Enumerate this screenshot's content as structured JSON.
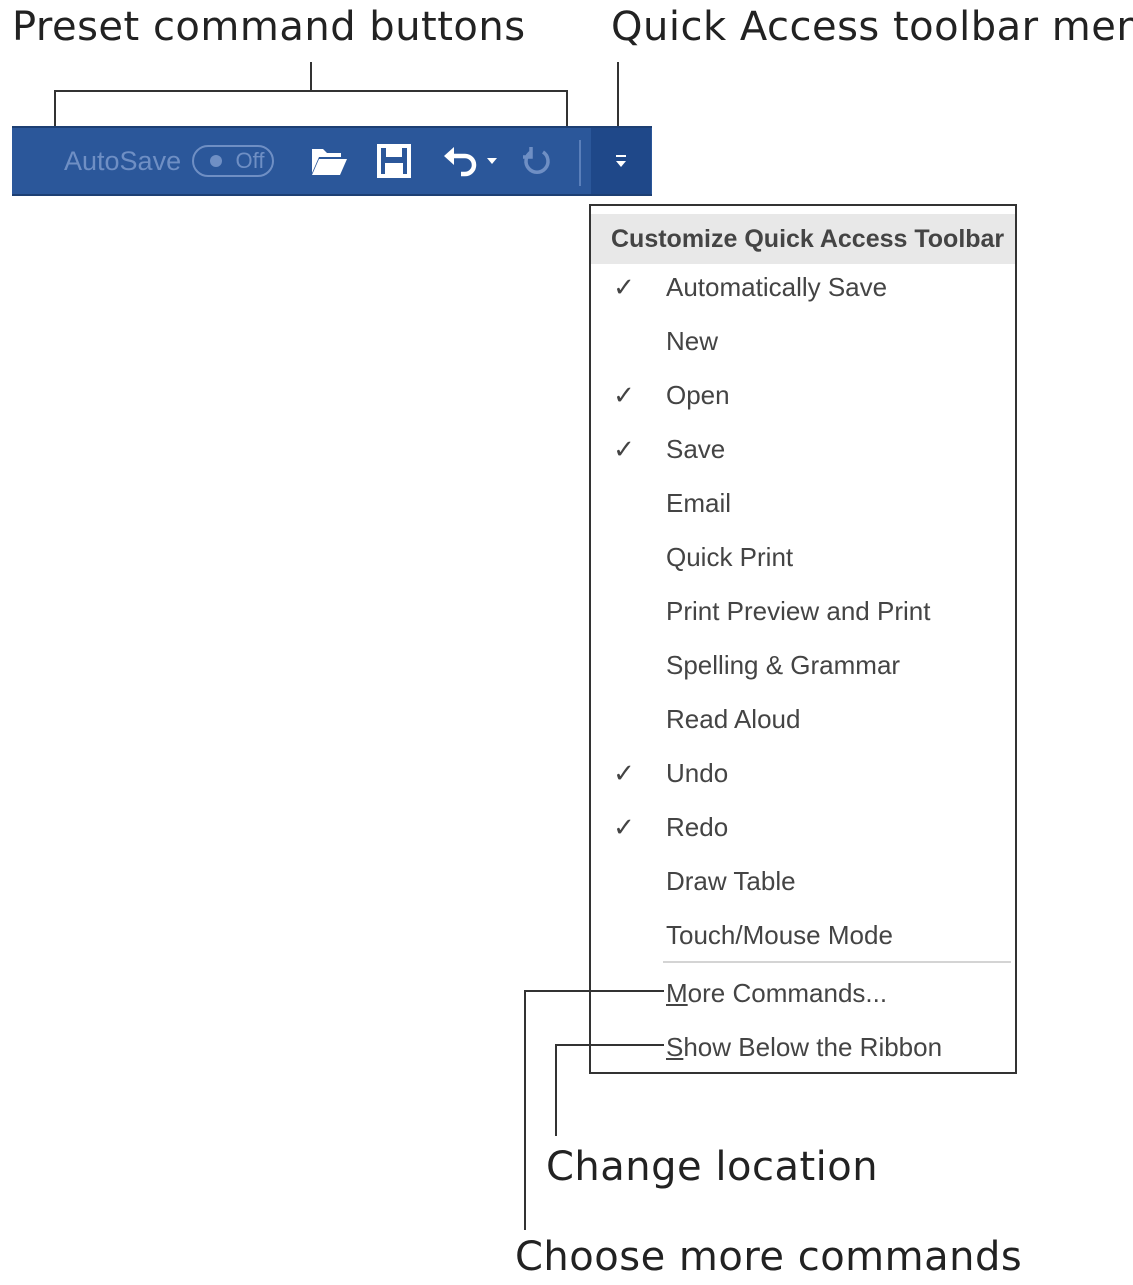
{
  "callouts": {
    "preset_buttons": "Preset command buttons",
    "qat_menu": "Quick Access toolbar menu",
    "change_location": "Change location",
    "more_commands": "Choose more commands"
  },
  "toolbar": {
    "autosave_label": "AutoSave",
    "autosave_state": "Off",
    "icons": [
      "open-folder-icon",
      "save-icon",
      "undo-icon",
      "dropdown-arrow-icon",
      "redo-icon",
      "customize-qat-icon"
    ],
    "bg_color": "#2b579a"
  },
  "menu": {
    "header": "Customize Quick Access Toolbar",
    "items": [
      {
        "label": "Automatically Save",
        "checked": true
      },
      {
        "label": "New",
        "checked": false
      },
      {
        "label": "Open",
        "checked": true
      },
      {
        "label": "Save",
        "checked": true
      },
      {
        "label": "Email",
        "checked": false
      },
      {
        "label": "Quick Print",
        "checked": false
      },
      {
        "label": "Print Preview and Print",
        "checked": false
      },
      {
        "label": "Spelling & Grammar",
        "checked": false
      },
      {
        "label": "Read Aloud",
        "checked": false
      },
      {
        "label": "Undo",
        "checked": true
      },
      {
        "label": "Redo",
        "checked": true
      },
      {
        "label": "Draw Table",
        "checked": false
      },
      {
        "label": "Touch/Mouse Mode",
        "checked": false
      }
    ],
    "more_commands": {
      "key": "M",
      "rest": "ore Commands..."
    },
    "show_below": {
      "key": "S",
      "rest": "how Below the Ribbon"
    },
    "check_glyph": "✓"
  }
}
